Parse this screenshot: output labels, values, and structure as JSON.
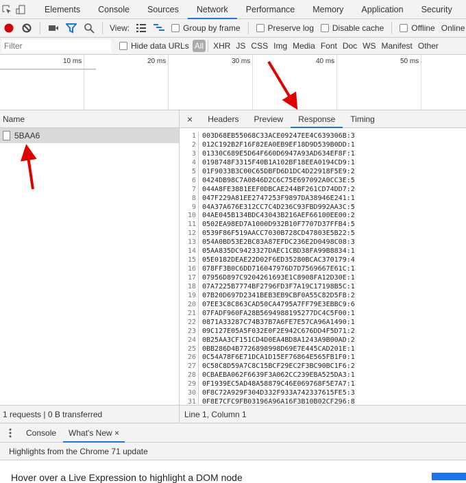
{
  "tabs": {
    "items": [
      "Elements",
      "Console",
      "Sources",
      "Network",
      "Performance",
      "Memory",
      "Application",
      "Security",
      "Au"
    ],
    "active": "Network"
  },
  "toolbar": {
    "view_label": "View:",
    "group_by_frame": "Group by frame",
    "preserve_log": "Preserve log",
    "disable_cache": "Disable cache",
    "offline": "Offline",
    "online": "Online",
    "record_color": "#d50000",
    "accent": "#1a73e8"
  },
  "filterbar": {
    "placeholder": "Filter",
    "hide_data_urls": "Hide data URLs",
    "types": [
      "All",
      "XHR",
      "JS",
      "CSS",
      "Img",
      "Media",
      "Font",
      "Doc",
      "WS",
      "Manifest",
      "Other"
    ]
  },
  "overview": {
    "ticks": [
      "10 ms",
      "20 ms",
      "30 ms",
      "40 ms",
      "50 ms"
    ]
  },
  "requests": {
    "header": "Name",
    "rows": [
      {
        "name": "5BAA6",
        "selected": true
      }
    ]
  },
  "detail": {
    "close": "×",
    "tabs": [
      "Headers",
      "Preview",
      "Response",
      "Timing"
    ],
    "active": "Response",
    "lines": [
      "003D68EB55068C33ACE09247EE4C639306B:3",
      "012C192B2F16F82EA0EB9EF18D9D539B0DD:1",
      "01330C689E5D64F660D6947A93AD634EF8F:1",
      "0198748F3315F40B1A102BF18EEA0194CD9:1",
      "01F9033B3C00C65DBFD6D1DC4D22918F5E9:2",
      "0424DB98C7A0846D2C6C75E697092A0CC3E:5",
      "044A8FE3881EEF0DBCAE244BF261CD74DD7:2",
      "047F229A81EE2747253F9897DA38946E241:1",
      "04A37A676E312CC7C4D236C93FBD992AA3C:5",
      "04AE045B134BDC43043B216AEF66100EE00:2",
      "0502EA98ED7A1000D932B10F7707D37FFB4:5",
      "0539F86F519AACC7030B728CD47803E5B22:5",
      "054A0BD53E2BC83A87EFDC236E2D0498C08:3",
      "05AA835DC9423327DAEC1CBD38FA99B8834:1",
      "05E0182DEAE22D02F6ED35280BCAC370179:4",
      "078FF3B0C6DD716047976D7D7569667E61C:1",
      "07956D897C9204261693E1C8908FA12D30E:1",
      "07A7225B7774BF2796FD3F7A19C17198B5C:1",
      "07B20D697D2341BEB3EB9CBF0A55C82D5FB:2",
      "07EE3C8C863CAD50CA4795A7FF79E3EBBC9:6",
      "07FADF960FA28B5694988195277DC4C5F00:1",
      "0871A33287C74B37B7A6FE7E57CA96A1490:1",
      "09C127E05A5F032E0F2E942C676DD4F5D71:2",
      "0B25AA3CF151CD4D0EA4BD8A1243A9B00AD:2",
      "0BB286D4B7726898998D69E7E445CAD201E:1",
      "0C54A78F6E71DCA1D15EF76864E565FB1F0:1",
      "0C58C8D59A7C8C15BCF29EC2F3BC90BC1F6:2",
      "0CBAEBA062F6639F3A062CC239EBA525DA3:1",
      "0F1939EC5AD48A58879C46E069768F5E7A7:1",
      "0F8C72A929F304D332F933A742337615FE5:3",
      "0F8E7CFC9FB03196A96A16F3B10B02CF296:8"
    ]
  },
  "status": {
    "left": "1 requests | 0 B transferred",
    "right": "Line 1, Column 1"
  },
  "drawer": {
    "tabs": [
      "Console",
      "What's New"
    ],
    "active": "What's New",
    "close": "×",
    "highlights": "Highlights from the Chrome 71 update",
    "hover_text": "Hover over a Live Expression to highlight a DOM node"
  },
  "annotation_color": "#e00000"
}
